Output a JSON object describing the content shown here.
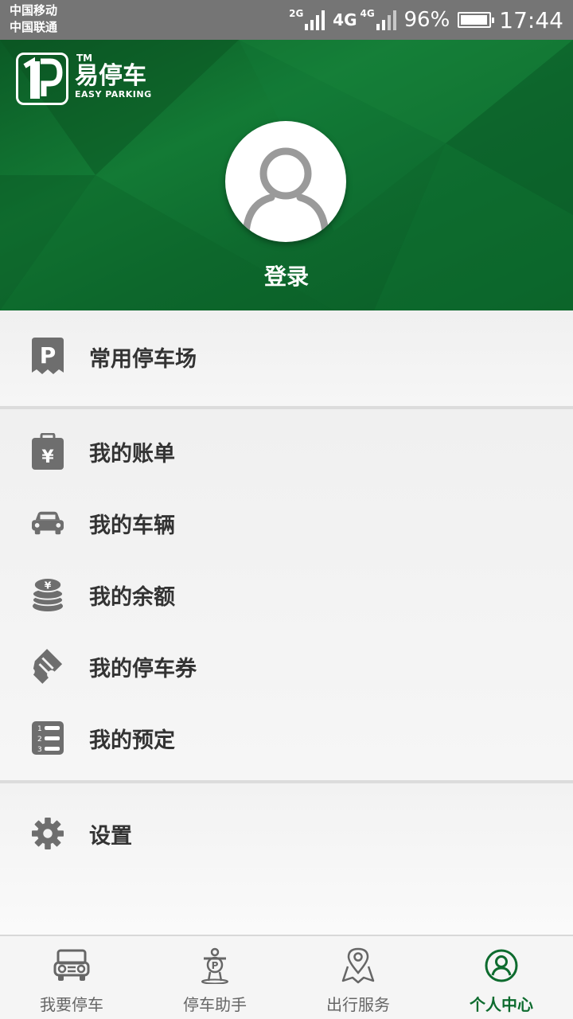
{
  "status_bar": {
    "carrier_1": "中国移动",
    "carrier_2": "中国联通",
    "sig1_label": "2G",
    "net_label": "4G",
    "sig2_label": "4G",
    "battery": "96%",
    "battery_level": 0.96,
    "time": "17:44"
  },
  "header": {
    "logo_tm": "TM",
    "logo_cn": "易停车",
    "logo_en": "EASY PARKING",
    "login_label": "登录"
  },
  "menu": {
    "favorites": "常用停车场",
    "bills": "我的账单",
    "vehicles": "我的车辆",
    "balance": "我的余额",
    "coupons": "我的停车券",
    "reservations": "我的预定",
    "settings": "设置"
  },
  "nav": {
    "tab_park": "我要停车",
    "tab_assistant": "停车助手",
    "tab_travel": "出行服务",
    "tab_profile": "个人中心",
    "active": "tab_profile"
  },
  "colors": {
    "brand_green": "#0d6b2e",
    "icon_gray": "#6e6e6e",
    "status_bar": "#757575"
  }
}
